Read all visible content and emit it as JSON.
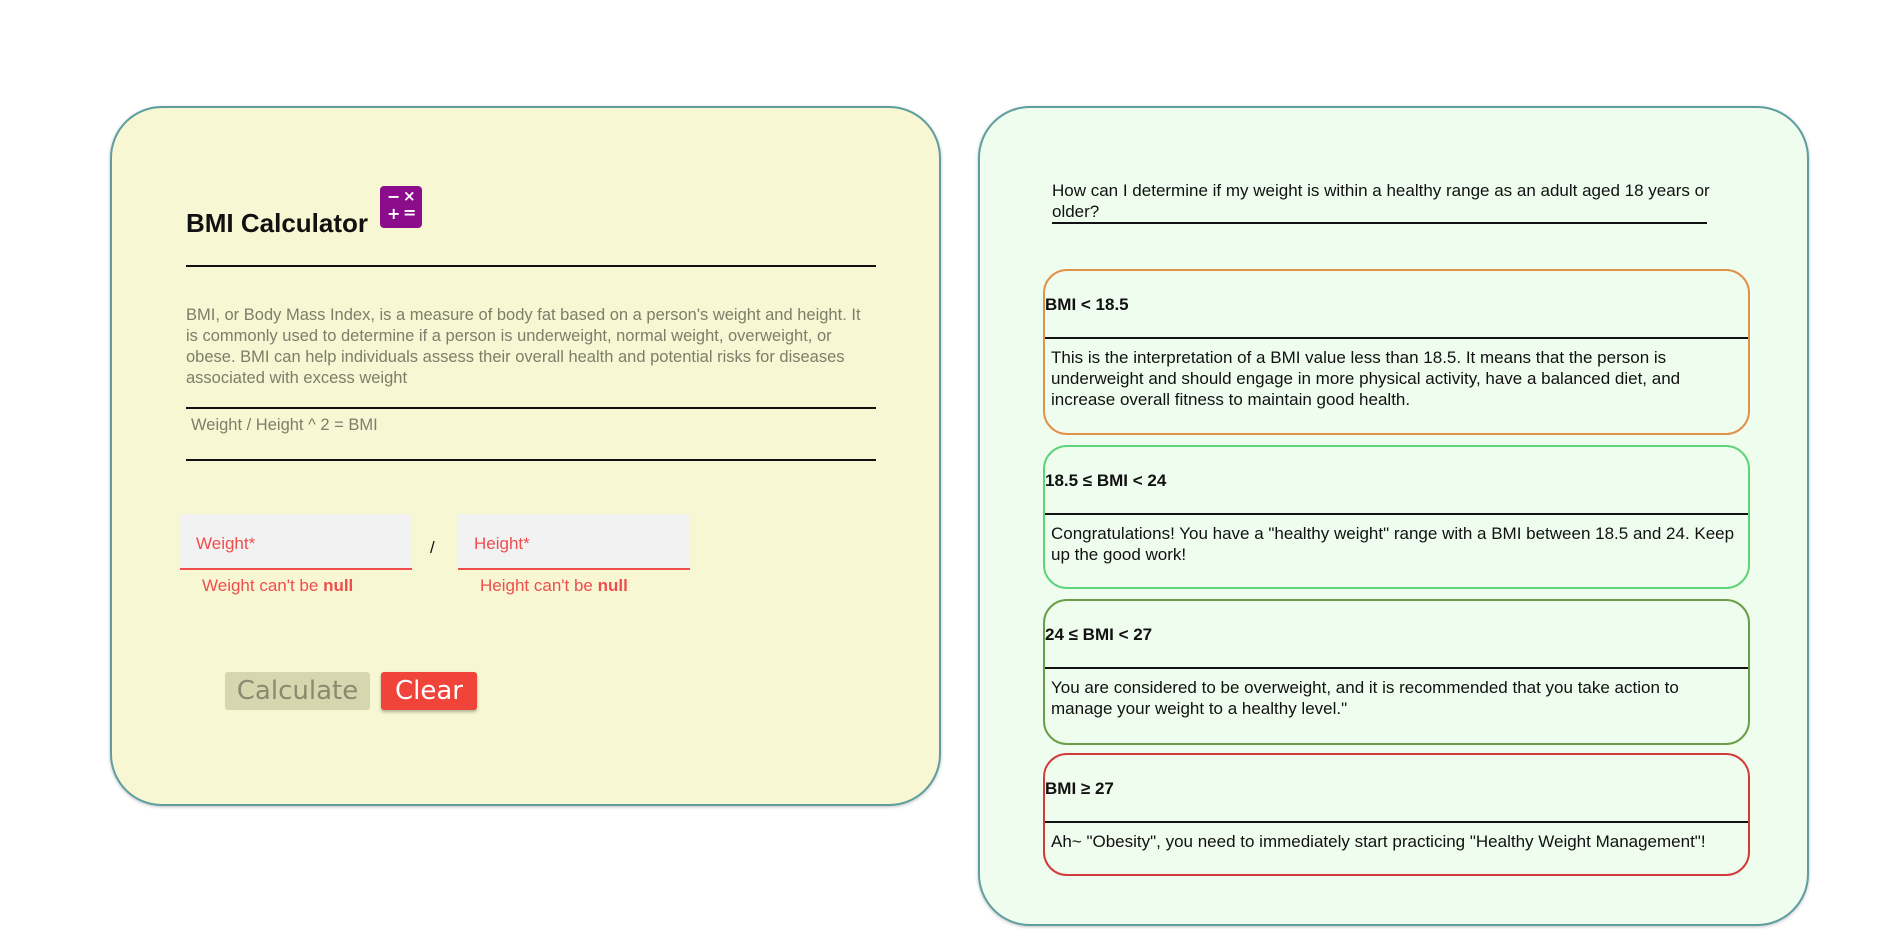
{
  "calculator": {
    "title": "BMI Calculator",
    "icon": "calculator-icon",
    "icon_color": "#8b0d8b",
    "description": "BMI, or Body Mass Index, is a measure of body fat based on a person's weight and height. It is commonly used to determine if a person is underweight, normal weight, overweight, or obese. BMI can help individuals assess their overall health and potential risks for diseases associated with excess weight",
    "formula": "Weight / Height ^ 2 = BMI",
    "weight": {
      "label": "Weight*",
      "value": "",
      "error_prefix": "Weight can't be ",
      "error_bold": "null"
    },
    "separator": "/",
    "height": {
      "label": "Height*",
      "value": "",
      "error_prefix": "Height can't be ",
      "error_bold": "null"
    },
    "buttons": {
      "calculate_label": "Calculate",
      "clear_label": "Clear"
    },
    "colors": {
      "panel_bg": "#f7f8d3",
      "error": "#f04d4d",
      "clear_button": "#f0443a",
      "calculate_button": "#d7d6ae"
    }
  },
  "info": {
    "question": "How can I determine if my weight is within a healthy range as an adult aged 18 years or older?",
    "panel_bg": "#effdef",
    "cards": [
      {
        "title": "BMI < 18.5",
        "body": "This is the interpretation of a BMI value less than 18.5. It means that the person is underweight and should engage in more physical activity, have a balanced diet, and increase overall fitness to maintain good health.",
        "border_color": "#e0914a"
      },
      {
        "title": "18.5 ≤ BMI < 24",
        "body": "Congratulations! You have a \"healthy weight\" range with a BMI between 18.5 and 24. Keep up the good work!",
        "border_color": "#5fd37a"
      },
      {
        "title": "24 ≤ BMI < 27",
        "body": "You are considered to be overweight, and it is recommended that you take action to manage your weight to a healthy level.\"",
        "border_color": "#6a9f45"
      },
      {
        "title": "BMI ≥ 27",
        "body": "Ah~ \"Obesity\", you need to immediately start practicing \"Healthy Weight Management\"!",
        "border_color": "#d33a3a"
      }
    ]
  }
}
